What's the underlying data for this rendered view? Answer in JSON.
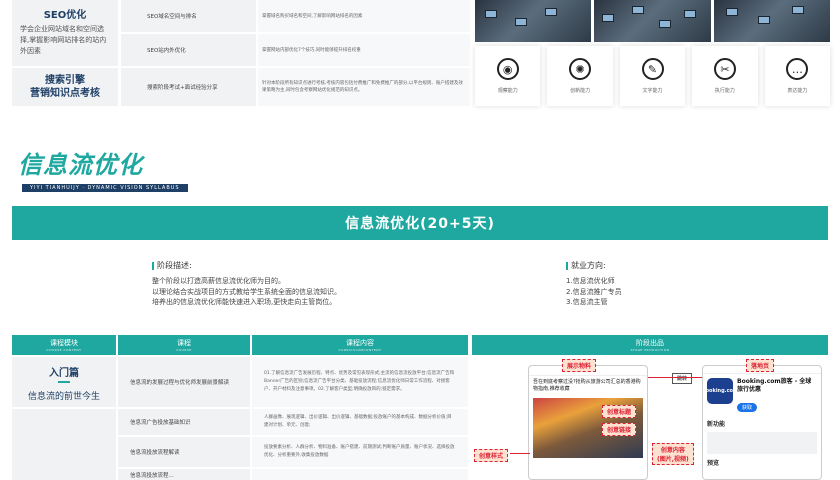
{
  "seo": {
    "left_title": "SEO优化",
    "left_desc": "学会企业网站域名和空间选择,掌握影响网站排名的站内外因素",
    "left2_line1": "搜索引擎",
    "left2_line2": "营销知识点考核",
    "rows": [
      {
        "course": "SEO域名空间与排名",
        "content": "掌握域名购买域名和空间,了解影响网站排名的因素"
      },
      {
        "course": "SEO站内外优化",
        "content": "掌握网站内部优化7个技巧,同时能够提升排名权重"
      },
      {
        "course": "搜索阶段考试+面试经验分享",
        "content": "针对本阶段所有知识点进行考核,考核内容包括付费推广和免费推广的部分,以平台规则、账户搭建及效果策略为主,同时包含考察网站优化规范的知识点。"
      }
    ]
  },
  "abilities": [
    {
      "icon": "eye-icon",
      "glyph": "◉",
      "label": "观察能力"
    },
    {
      "icon": "lightbulb-icon",
      "glyph": "✺",
      "label": "创新能力"
    },
    {
      "icon": "pencil-icon",
      "glyph": "✎",
      "label": "文字能力"
    },
    {
      "icon": "wrench-icon",
      "glyph": "✂",
      "label": "执行能力"
    },
    {
      "icon": "chat-icon",
      "glyph": "…",
      "label": "表达能力"
    }
  ],
  "section": {
    "title": "信息流优化",
    "subtitle": "YIYI TIANHUIJY · DYNAMIC VISION SYLLABUS",
    "banner": "信息流优化(20+5天)"
  },
  "stage": {
    "heading": "阶段描述:",
    "lines": [
      "整个阶段以打造高薪信息流优化师为目的。",
      "以理论结合实战项目的方式教给学生系统全面的信息流知识。",
      "培养出的信息流优化师能快速进入职场,更快走向主管岗位。"
    ]
  },
  "direction": {
    "heading": "就业方向:",
    "lines": [
      "1.信息流优化师",
      "2.信息流推广专员",
      "3.信息流主管"
    ]
  },
  "table": {
    "headers": [
      {
        "cn": "课程模块",
        "en": "COURSE CONTENT"
      },
      {
        "cn": "课程",
        "en": "COURSE"
      },
      {
        "cn": "课程内容",
        "en": "CURRICULUMCONTENT"
      },
      {
        "cn": "阶段出品",
        "en": "STAGE PRODUCTION"
      }
    ],
    "module_title": "入门篇",
    "module_sub": "信息流的前世今生",
    "rows": [
      {
        "course": "信息流的发展过程与优化师发展前景解读",
        "content": "01.了解信息流广告发展历程、特点、优势及常见表现形式;主流的信息流投放平台;信息流广告和Banner广告的区别;信息流广告平台分类、基础投放流程;信息流优化师日常工作流程、对接客户、开户材料及注意事项。02.了解客户类型;明确投放目的;锁定需求。"
      },
      {
        "course": "信息流广告投放基础知识",
        "content": "人群画像、展现逻辑、出价逻辑、出价逻辑、基础数据;投放账户的基本构成、数据分析价值;目建对计划、单元、创意;"
      },
      {
        "course": "信息流投放流程解读",
        "content": "投放要素分析、人群分析、物料准备、账户搭建、前期测试;判断账户质量、账户状况、选择投放优化、分析重要外,收集投放数据"
      },
      {
        "course": "信息流投放流程...",
        "content": ""
      }
    ]
  },
  "output": {
    "tag_material": "展示物料",
    "tag_landing": "落地页",
    "tag_material_style": "创意样式",
    "tag_creative": "创意标题",
    "tag_creative_content": "创意内容\n(图片,视频)",
    "tag_link": "创意链接",
    "tag_jump": "跳转",
    "feed_title": "吾在到底考察过没?抢购从旅游公司汇总的香港购物指南,推荐收藏",
    "app_name": "Booking.com旅客 - 全球旅行优惠",
    "app_sub": "Booking.com",
    "app_get": "获取",
    "app_section": "新功能",
    "app_section2": "预览"
  },
  "colors": {
    "teal": "#1fa8a0",
    "navy": "#1e3f66",
    "red": "#d22233"
  }
}
